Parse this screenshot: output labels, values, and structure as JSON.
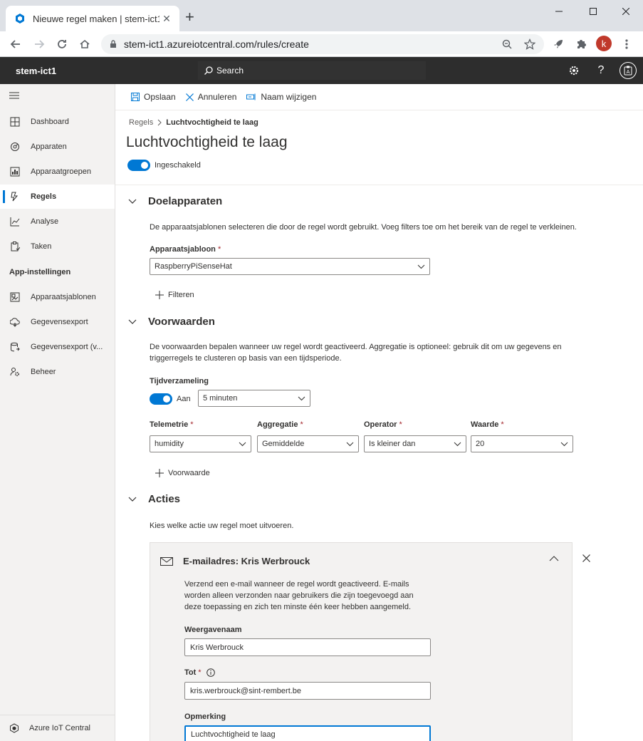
{
  "browser": {
    "tab_title": "Nieuwe regel maken | stem-ict1",
    "url": "stem-ict1.azureiotcentral.com/rules/create",
    "profile_initial": "k"
  },
  "header": {
    "app_name": "stem-ict1",
    "search_label": "Search"
  },
  "sidebar": {
    "items": [
      {
        "label": "Dashboard",
        "icon": "dashboard-icon"
      },
      {
        "label": "Apparaten",
        "icon": "devices-icon"
      },
      {
        "label": "Apparaatgroepen",
        "icon": "device-groups-icon"
      },
      {
        "label": "Regels",
        "icon": "rules-icon",
        "active": true
      },
      {
        "label": "Analyse",
        "icon": "analytics-icon"
      },
      {
        "label": "Taken",
        "icon": "jobs-icon"
      }
    ],
    "section_title": "App-instellingen",
    "settings_items": [
      {
        "label": "Apparaatsjablonen",
        "icon": "device-templates-icon"
      },
      {
        "label": "Gegevensexport",
        "icon": "data-export-icon"
      },
      {
        "label": "Gegevensexport (v...",
        "icon": "data-export-legacy-icon"
      },
      {
        "label": "Beheer",
        "icon": "administration-icon"
      }
    ],
    "footer": "Azure IoT Central"
  },
  "toolbar": {
    "save": "Opslaan",
    "cancel": "Annuleren",
    "rename": "Naam wijzigen"
  },
  "breadcrumb": {
    "parent": "Regels",
    "current": "Luchtvochtigheid te laag"
  },
  "page": {
    "title": "Luchtvochtigheid te laag",
    "enabled_label": "Ingeschakeld"
  },
  "target": {
    "heading": "Doelapparaten",
    "description": "De apparaatsjablonen selecteren die door de regel wordt gebruikt. Voeg filters toe om het bereik van de regel te verkleinen.",
    "template_label": "Apparaatsjabloon",
    "template_value": "RaspberryPiSenseHat",
    "filter_label": "Filteren"
  },
  "conditions": {
    "heading": "Voorwaarden",
    "description_line1": "De voorwaarden bepalen wanneer uw regel wordt geactiveerd. Aggregatie is optioneel: gebruik dit om uw gegevens en",
    "description_line2": "triggerregels te clusteren op basis van een tijdsperiode.",
    "time_agg_label": "Tijdverzameling",
    "time_agg_toggle": "Aan",
    "time_agg_value": "5 minuten",
    "telemetry_label": "Telemetrie",
    "telemetry_value": "humidity",
    "aggregation_label": "Aggregatie",
    "aggregation_value": "Gemiddelde",
    "operator_label": "Operator",
    "operator_value": "Is kleiner dan",
    "value_label": "Waarde",
    "value_value": "20",
    "add_condition": "Voorwaarde"
  },
  "actions": {
    "heading": "Acties",
    "description": "Kies welke actie uw regel moet uitvoeren.",
    "card_title": "E-mailadres: Kris Werbrouck",
    "card_desc_line1": "Verzend een e-mail wanneer de regel wordt geactiveerd. E-mails",
    "card_desc_line2": "worden alleen verzonden naar gebruikers die zijn toegevoegd aan",
    "card_desc_line3": "deze toepassing en zich ten minste één keer hebben aangemeld.",
    "display_name_label": "Weergavenaam",
    "display_name_value": "Kris Werbrouck",
    "to_label": "Tot",
    "to_value": "kris.werbrouck@sint-rembert.be",
    "note_label": "Opmerking",
    "note_value": "Luchtvochtigheid te laag"
  },
  "required_mark": "*"
}
